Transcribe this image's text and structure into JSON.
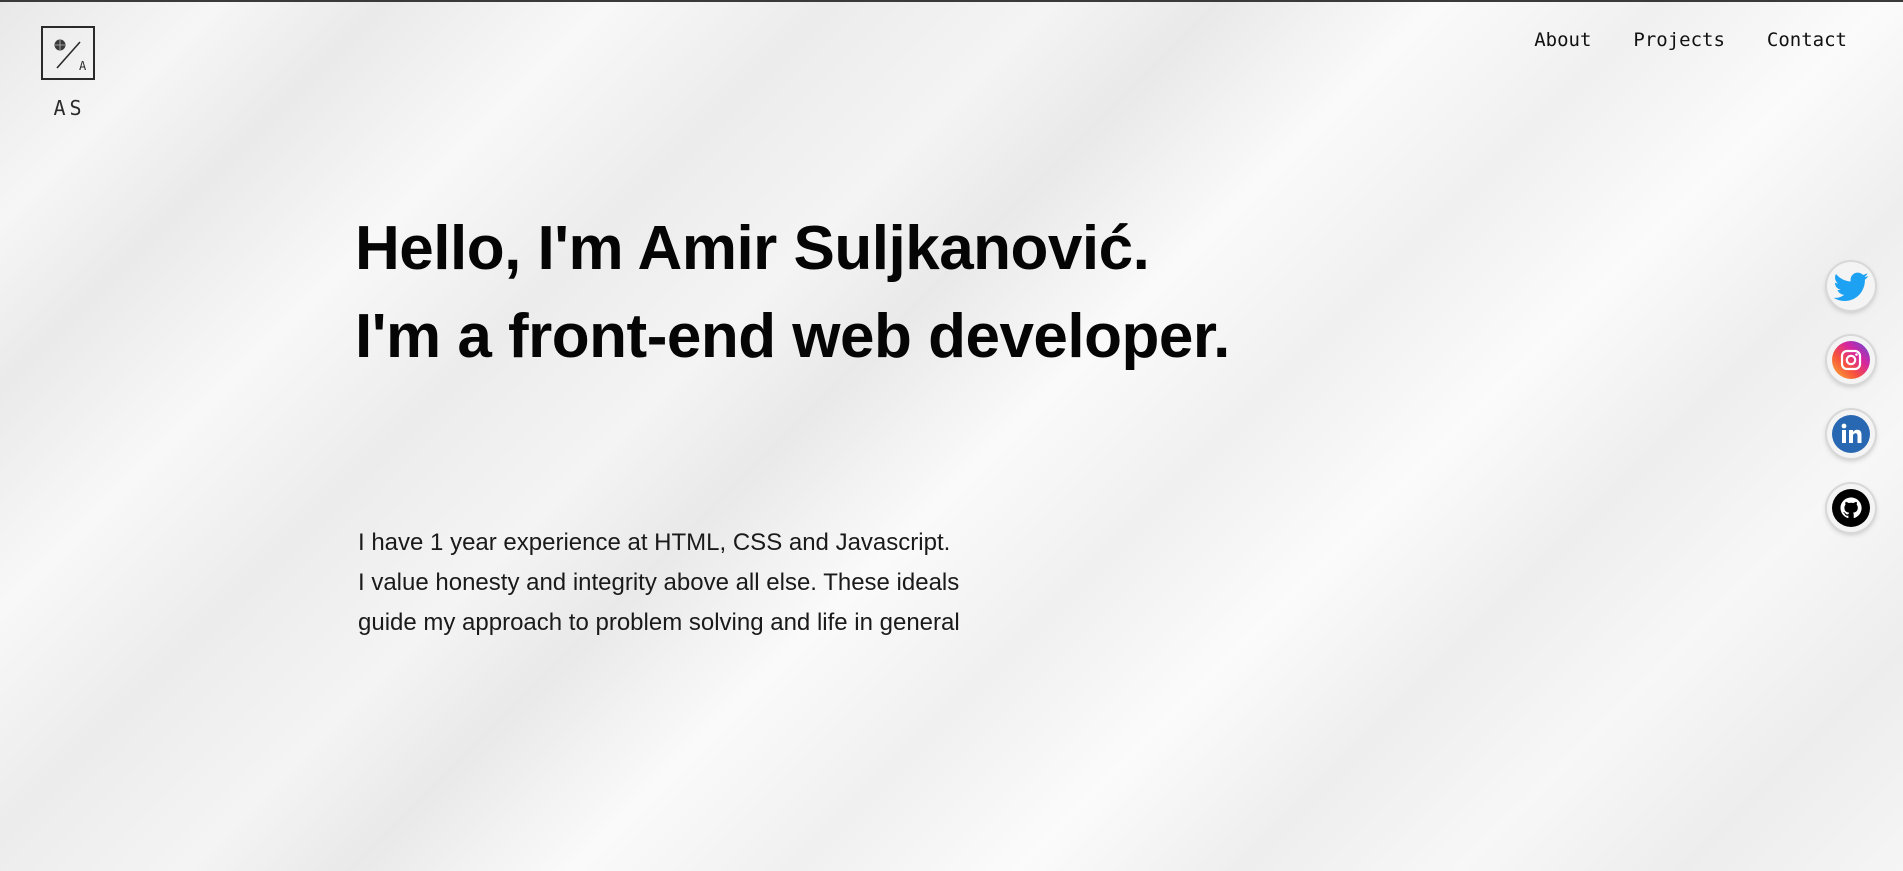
{
  "logo": {
    "initials": "AS"
  },
  "nav": {
    "about": "About",
    "projects": "Projects",
    "contact": "Contact"
  },
  "hero": {
    "line1": "Hello, I'm Amir Suljkanović.",
    "line2": "I'm a front-end web developer."
  },
  "about": {
    "line1": "I have 1 year experience at HTML, CSS and Javascript.",
    "line2": "I value honesty and integrity above all else. These ideals",
    "line3": "guide my approach to problem solving and life in general"
  },
  "socials": [
    {
      "icon": "twitter-icon",
      "color": "#1da1f2"
    },
    {
      "icon": "instagram-icon",
      "color": "#d6249f"
    },
    {
      "icon": "linkedin-icon",
      "color": "#2867b2"
    },
    {
      "icon": "github-icon",
      "color": "#000000"
    }
  ],
  "colors": {
    "text": "#050505",
    "background": "#efefef"
  }
}
